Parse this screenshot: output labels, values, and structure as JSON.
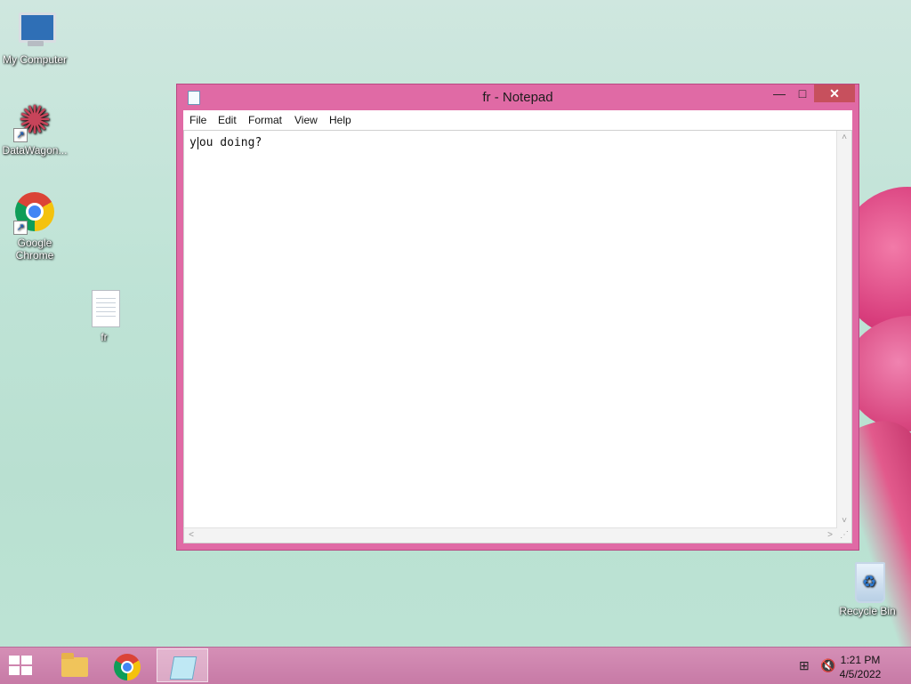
{
  "desktop": {
    "icons": [
      {
        "label": "My Computer"
      },
      {
        "label": "DataWagon..."
      },
      {
        "label_line1": "Google",
        "label_line2": "Chrome"
      },
      {
        "label": "fr"
      },
      {
        "label": "Recycle Bin"
      }
    ]
  },
  "notepad": {
    "title": "fr - Notepad",
    "menu": [
      "File",
      "Edit",
      "Format",
      "View",
      "Help"
    ],
    "content_before_caret": "y",
    "content_after_caret": "ou doing?",
    "buttons": {
      "minimize": "—",
      "maximize": "□",
      "close": "✕"
    },
    "scroll": {
      "up": "˄",
      "down": "˅",
      "left": "˂",
      "right": "˃",
      "grip": "⋰"
    }
  },
  "taskbar": {
    "apps": [
      {
        "name": "File Explorer",
        "icon": "folder-icon",
        "active": false
      },
      {
        "name": "Google Chrome",
        "icon": "chrome-icon",
        "active": false
      },
      {
        "name": "Notepad",
        "icon": "notepad-icon",
        "active": true
      }
    ],
    "tray": {
      "network_icon": "⊞",
      "volume_icon": "🔇"
    },
    "clock": {
      "time": "1:21 PM",
      "date": "4/5/2022"
    }
  },
  "colors": {
    "window_frame": "#e06aa5",
    "close_button": "#c7505d",
    "taskbar": "#c77aa6"
  }
}
